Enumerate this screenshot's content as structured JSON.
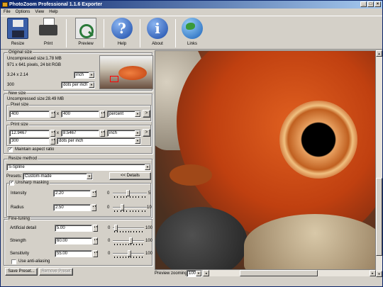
{
  "window": {
    "title": "PhotoZoom Professional 1.1.6 Exporter"
  },
  "menu": [
    "File",
    "Options",
    "View",
    "Help"
  ],
  "toolbar": [
    {
      "label": "Resize",
      "icon": "floppy-disk-icon"
    },
    {
      "label": "Print",
      "icon": "printer-icon"
    },
    {
      "label": "Preview",
      "icon": "magnifier-icon"
    },
    {
      "label": "Help",
      "icon": "help-question-icon",
      "glyph": "?"
    },
    {
      "label": "About",
      "icon": "info-icon",
      "glyph": "i"
    },
    {
      "label": "Links",
      "icon": "globe-icon"
    }
  ],
  "original": {
    "title": "Original size",
    "uncompressed": "Uncompressed size:1.78 MB",
    "pixels": "971 x 641 pixels, 24 bit RGB",
    "dims": "3.24 x 2.14",
    "unit": "inch",
    "resolution": "300",
    "res_unit": "dots per inch"
  },
  "newsize": {
    "title": "New size",
    "uncompressed": "Uncompressed size:28.49 MB",
    "pixel_title": "Pixel size",
    "pixel_w": "400",
    "pixel_h": "400",
    "pixel_unit": "percent",
    "x": "x",
    "more": ">",
    "print_title": "Print size",
    "print_w": "12.9467",
    "print_h": "8.5467",
    "print_unit": "inch",
    "print_res": "300",
    "print_res_unit": "dots per inch",
    "maintain": "Maintain aspect ratio",
    "maintain_checked": true
  },
  "resize": {
    "title": "Resize method",
    "method": "S-Spline",
    "presets_label": "Presets:",
    "preset": "Custom-made",
    "details": "<< Details",
    "unsharp": "Unsharp masking",
    "unsharp_checked": true,
    "intensity_label": "Intensity",
    "intensity": "2.20",
    "intensity_min": "0",
    "intensity_max": "5",
    "intensity_pos": 0.44,
    "radius_label": "Radius",
    "radius": "2.50",
    "radius_min": "0",
    "radius_max": "10",
    "radius_pos": 0.25
  },
  "finetune": {
    "title": "Fine-tuning",
    "artificial_label": "Artificial detail",
    "artificial": "5.00",
    "artificial_min": "0",
    "artificial_max": "100",
    "artificial_pos": 0.05,
    "strength_label": "Strength",
    "strength": "60.00",
    "strength_min": "0",
    "strength_max": "100",
    "strength_pos": 0.6,
    "sensitivity_label": "Sensitivity",
    "sensitivity": "55.00",
    "sensitivity_min": "0",
    "sensitivity_max": "100",
    "sensitivity_pos": 0.55,
    "antialias": "Use anti-aliasing",
    "antialias_checked": false
  },
  "buttons": {
    "save": "Save Preset...",
    "remove": "Remove Preset"
  },
  "preview": {
    "zoom_label": "Preview zooming:",
    "zoom": "100%"
  }
}
